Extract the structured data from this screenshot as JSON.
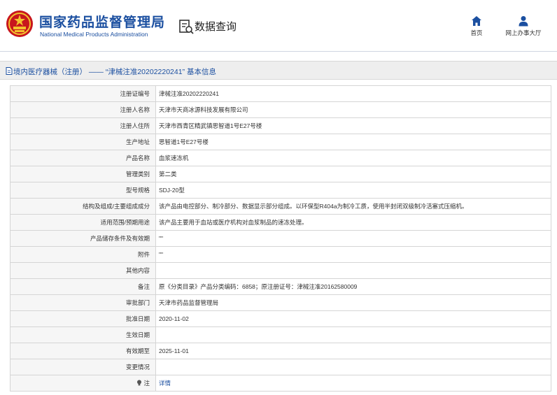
{
  "header": {
    "brand_cn": "国家药品监督管理局",
    "brand_en": "National Medical Products Administration",
    "query_label": "数据查询",
    "nav": [
      {
        "label": "首页",
        "icon": "home-icon"
      },
      {
        "label": "网上办事大厅",
        "icon": "user-icon"
      }
    ]
  },
  "titlebar": {
    "text": "境内医疗器械（注册） —— “津械注准20202220241” 基本信息"
  },
  "colors": {
    "brand_blue": "#1b4fa0",
    "emblem_red": "#c8161d",
    "emblem_gold": "#f3c12d"
  },
  "rows": [
    {
      "label": "注册证编号",
      "value": "津械注准20202220241"
    },
    {
      "label": "注册人名称",
      "value": "天津市天商冰源科技发展有限公司"
    },
    {
      "label": "注册人住所",
      "value": "天津市西青区精武镇思智道1号E27号楼"
    },
    {
      "label": "生产地址",
      "value": "思智道1号E27号楼"
    },
    {
      "label": "产品名称",
      "value": "血浆速冻机"
    },
    {
      "label": "管理类别",
      "value": "第二类"
    },
    {
      "label": "型号规格",
      "value": "SDJ-20型"
    },
    {
      "label": "结构及组成/主要组成成分",
      "value": "该产品由电控部分、制冷部分、数据显示部分组成。以环保型R404a为制冷工质，使用半封闭双级制冷活塞式压缩机。"
    },
    {
      "label": "适用范围/预期用途",
      "value": "该产品主要用于血站或医疗机构对血浆制品的速冻处理。"
    },
    {
      "label": "产品储存条件及有效期",
      "value": "\"\""
    },
    {
      "label": "附件",
      "value": "\"\""
    },
    {
      "label": "其他内容",
      "value": ""
    },
    {
      "label": "备注",
      "value": "原《分类目录》产品分类编码：6858；原注册证号：津械注准20162580009"
    },
    {
      "label": "审批部门",
      "value": "天津市药品监督管理局"
    },
    {
      "label": "批准日期",
      "value": "2020-11-02"
    },
    {
      "label": "生效日期",
      "value": ""
    },
    {
      "label": "有效期至",
      "value": "2025-11-01"
    },
    {
      "label": "变更情况",
      "value": ""
    }
  ],
  "note_row": {
    "label": "注",
    "icon": "info-bulb-icon",
    "link": "详情"
  }
}
